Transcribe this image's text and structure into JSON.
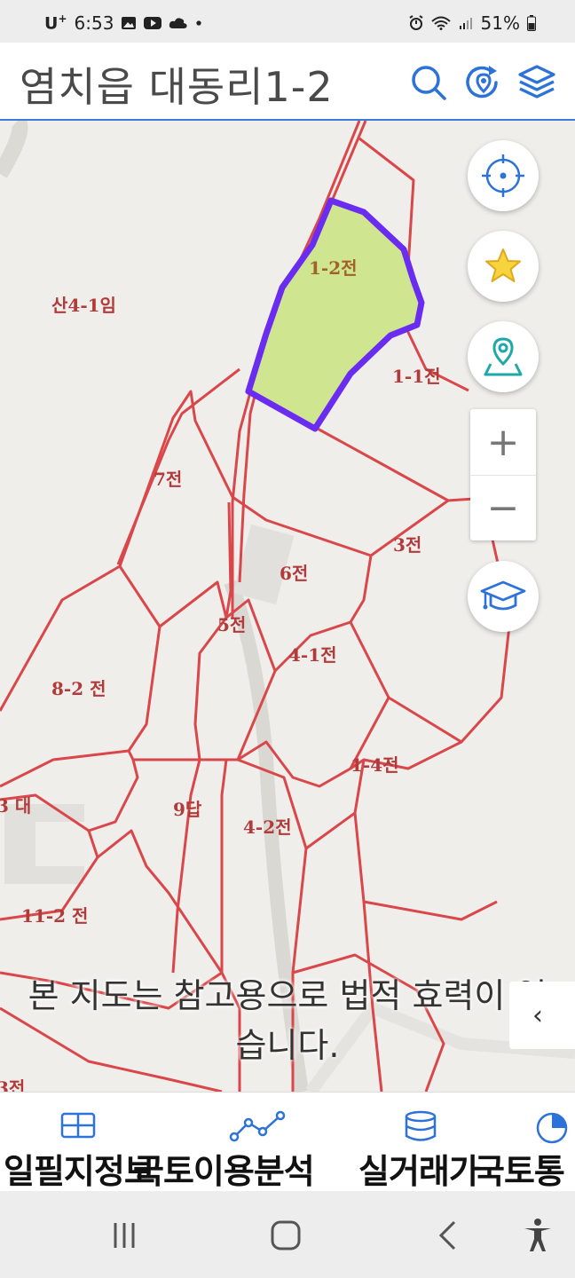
{
  "status_bar": {
    "carrier": "U",
    "carrier_suffix": "+",
    "time": "6:53",
    "battery": "51%",
    "icons": [
      "gallery-icon",
      "youtube-icon",
      "cloud-icon",
      "dot-icon",
      "alarm-icon",
      "wifi-icon",
      "signal-icon",
      "battery-icon"
    ]
  },
  "header": {
    "title": "염치읍 대동리1-2",
    "buttons": [
      "search-icon",
      "location-refresh-icon",
      "layers-icon"
    ]
  },
  "map": {
    "parcels": [
      {
        "label": "1-2전",
        "selected": true
      },
      {
        "label": "산4-1임"
      },
      {
        "label": "1-1전"
      },
      {
        "label": "7전"
      },
      {
        "label": "3전"
      },
      {
        "label": "6전"
      },
      {
        "label": "5전"
      },
      {
        "label": "4-1전"
      },
      {
        "label": "8-2 전"
      },
      {
        "label": "1-4전"
      },
      {
        "label": "3 대"
      },
      {
        "label": "9답"
      },
      {
        "label": "4-2전"
      },
      {
        "label": "11-2 전"
      },
      {
        "label": "3전"
      }
    ],
    "controls": {
      "zoom_in": "+",
      "zoom_out": "−",
      "fab_icons": [
        "crosshair-icon",
        "star-icon",
        "map-pin-icon",
        "graduation-cap-icon"
      ]
    },
    "disclaimer_line1": "본 지도는 참고용으로 법적 효력이 없",
    "disclaimer_line2": "습니다.",
    "side_tab": "‹",
    "colors": {
      "parcel_line": "#d9474a",
      "selected_fill": "#cfe58f",
      "selected_stroke": "#6a2cf0"
    }
  },
  "bottom_nav": {
    "items": [
      {
        "label": "일필지정보",
        "icon": "grid-icon"
      },
      {
        "label": "국토이용분석",
        "icon": "line-chart-icon"
      },
      {
        "label": "실거래가",
        "icon": "database-icon"
      },
      {
        "label": "국토통",
        "icon": "pie-chart-icon"
      }
    ]
  },
  "system_nav": {
    "buttons": [
      "recent-apps-icon",
      "home-icon",
      "back-icon",
      "accessibility-icon"
    ]
  }
}
